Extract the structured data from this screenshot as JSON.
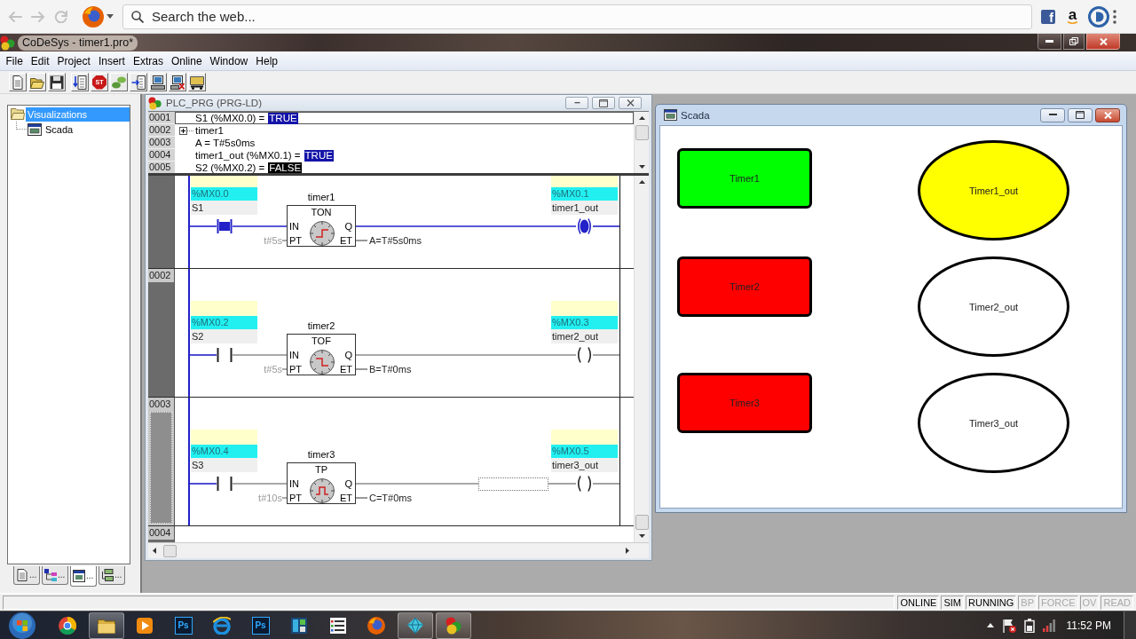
{
  "browser": {
    "nav": [
      {
        "kind": "back",
        "disabled": true
      },
      {
        "kind": "forward",
        "disabled": true
      },
      {
        "kind": "reload",
        "disabled": true
      }
    ],
    "search": {
      "placeholder": "Search the web..."
    },
    "extensions": [
      {
        "kind": "square",
        "text": "f"
      },
      {
        "kind": "smile",
        "text": "a"
      },
      {
        "kind": "ring"
      }
    ]
  },
  "app": {
    "title": "CoDeSys - timer1.pro*",
    "menu": [
      "File",
      "Edit",
      "Project",
      "Insert",
      "Extras",
      "Online",
      "Window",
      "Help"
    ],
    "toolbar": [
      [
        {
          "kind": "page"
        },
        {
          "kind": "folder"
        },
        {
          "kind": "disk"
        }
      ],
      [
        {
          "kind": "download"
        },
        {
          "kind": "stop",
          "text": "ST"
        },
        {
          "kind": "leaves"
        },
        {
          "kind": "upload"
        },
        {
          "kind": "computer"
        },
        {
          "kind": "disconnect"
        },
        {
          "kind": "cart"
        }
      ]
    ]
  },
  "organizer": {
    "tree": [
      {
        "label": "Visualizations",
        "selected": true,
        "children": [
          {
            "label": "Scada",
            "selected": false
          }
        ]
      }
    ],
    "tabs": [
      {
        "kind": "pous",
        "label": "...",
        "selected": false
      },
      {
        "kind": "types",
        "label": "...",
        "selected": false
      },
      {
        "kind": "visuals",
        "label": "...",
        "selected": true
      },
      {
        "kind": "resources",
        "label": "...",
        "selected": false
      }
    ]
  },
  "editor": {
    "title": "PLC_PRG (PRG-LD)",
    "declarations": [
      {
        "number": "0001",
        "kind": "value",
        "text": "S1 (%MX0.0) =",
        "value": "TRUE",
        "on": true,
        "selected": true
      },
      {
        "number": "0002",
        "kind": "instance",
        "text": "timer1",
        "expanded": false,
        "selected": false
      },
      {
        "number": "0003",
        "kind": "plain",
        "text": "A = T#5s0ms",
        "selected": false
      },
      {
        "number": "0004",
        "kind": "value",
        "text": "timer1_out (%MX0.1) =",
        "value": "TRUE",
        "on": true,
        "selected": false
      },
      {
        "number": "0005",
        "kind": "value",
        "text": "S2 (%MX0.2) =",
        "value": "FALSE",
        "on": false,
        "selected": false
      }
    ],
    "networks": [
      {
        "kind": "timer",
        "selected": false,
        "cursor": false,
        "contact": {
          "address": "%MX0.0",
          "name": "S1",
          "on": true
        },
        "block": {
          "instance": "timer1",
          "type": "TON",
          "kind": "ondelay",
          "inputs": [
            "IN",
            "PT"
          ],
          "outputs": [
            "Q",
            "ET"
          ],
          "preset": "t#5s",
          "elapsed": "A=T#5s0ms"
        },
        "coil": {
          "address": "%MX0.1",
          "name": "timer1_out",
          "on": true
        }
      },
      {
        "number": "0002",
        "kind": "timer",
        "selected": false,
        "cursor": false,
        "contact": {
          "address": "%MX0.2",
          "name": "S2",
          "on": false
        },
        "block": {
          "instance": "timer2",
          "type": "TOF",
          "kind": "offdelay",
          "inputs": [
            "IN",
            "PT"
          ],
          "outputs": [
            "Q",
            "ET"
          ],
          "preset": "t#5s",
          "elapsed": "B=T#0ms"
        },
        "coil": {
          "address": "%MX0.3",
          "name": "timer2_out",
          "on": false
        }
      },
      {
        "number": "0003",
        "kind": "timer",
        "selected": true,
        "cursor": true,
        "contact": {
          "address": "%MX0.4",
          "name": "S3",
          "on": false
        },
        "block": {
          "instance": "timer3",
          "type": "TP",
          "kind": "pulse",
          "inputs": [
            "IN",
            "PT"
          ],
          "outputs": [
            "Q",
            "ET"
          ],
          "preset": "t#10s",
          "elapsed": "C=T#0ms"
        },
        "coil": {
          "address": "%MX0.5",
          "name": "timer3_out",
          "on": false
        }
      },
      {
        "number": "0004",
        "kind": "empty",
        "selected": false
      }
    ]
  },
  "scada": {
    "title": "Scada",
    "rows": [
      {
        "input": {
          "label": "Timer1",
          "color": "#00ff00"
        },
        "output": {
          "label": "Timer1_out",
          "color": "#ffff00"
        }
      },
      {
        "input": {
          "label": "Timer2",
          "color": "#ff0000"
        },
        "output": {
          "label": "Timer2_out",
          "color": "#ffffff"
        }
      },
      {
        "input": {
          "label": "Timer3",
          "color": "#ff0000"
        },
        "output": {
          "label": "Timer3_out",
          "color": "#ffffff"
        }
      }
    ]
  },
  "status": {
    "indicators": [
      {
        "label": "ONLINE",
        "active": true
      },
      {
        "label": "SIM",
        "active": true
      },
      {
        "label": "RUNNING",
        "active": true
      },
      {
        "label": "BP",
        "active": false
      },
      {
        "label": "FORCE",
        "active": false
      },
      {
        "label": "OV",
        "active": false
      },
      {
        "label": "READ",
        "active": false
      }
    ]
  },
  "taskbar": {
    "apps": [
      {
        "kind": "ring",
        "running": false
      },
      {
        "kind": "folder",
        "running": true
      },
      {
        "kind": "media",
        "running": false
      },
      {
        "kind": "letters",
        "text": "Ps",
        "running": false
      },
      {
        "kind": "eglobe",
        "running": false
      },
      {
        "kind": "letters",
        "text": "Ps",
        "running": false
      },
      {
        "kind": "panel",
        "running": false
      },
      {
        "kind": "list",
        "running": false
      },
      {
        "kind": "globe",
        "running": false
      },
      {
        "kind": "diamond",
        "running": true
      },
      {
        "kind": "balls",
        "running": true
      }
    ],
    "clock": "11:52 PM"
  }
}
